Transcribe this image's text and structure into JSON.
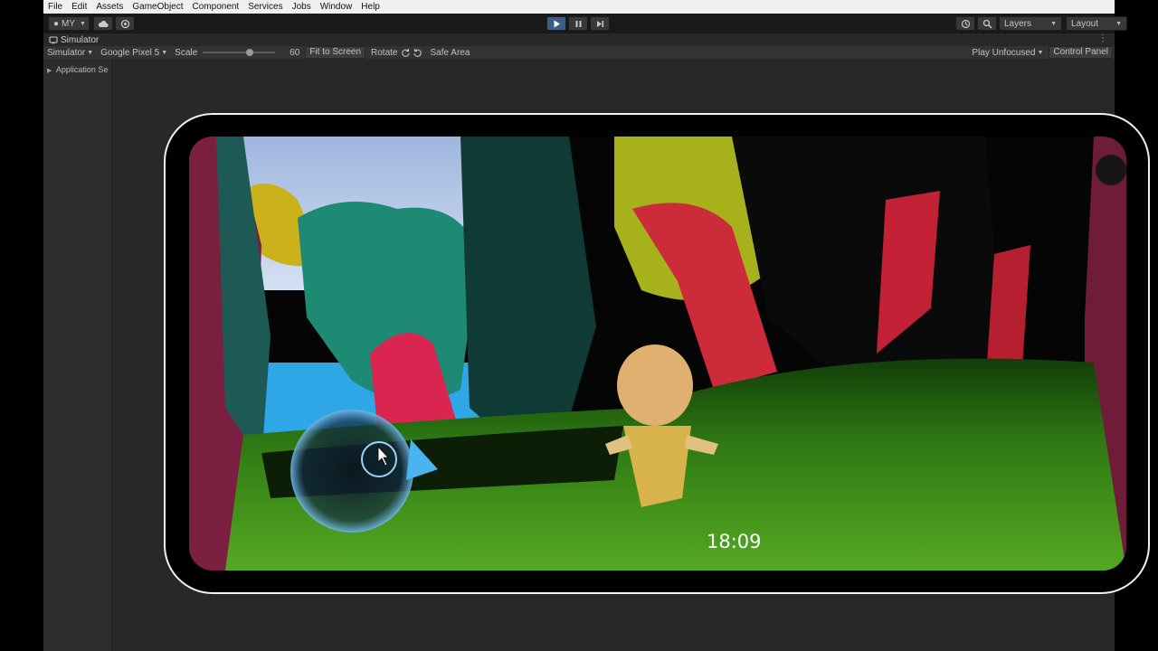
{
  "menubar": {
    "items": [
      "File",
      "Edit",
      "Assets",
      "GameObject",
      "Component",
      "Services",
      "Jobs",
      "Window",
      "Help"
    ]
  },
  "toolbar": {
    "account_label": "MY",
    "layers_label": "Layers",
    "layout_label": "Layout"
  },
  "window": {
    "tab_title": "Simulator"
  },
  "simbar": {
    "mode_label": "Simulator",
    "device_label": "Google Pixel 5",
    "scale_label": "Scale",
    "scale_value": "60",
    "fit_label": "Fit to Screen",
    "rotate_label": "Rotate",
    "safe_area_label": "Safe Area",
    "play_mode_label": "Play Unfocused",
    "control_panel_label": "Control Panel"
  },
  "sidebar": {
    "items": [
      {
        "label": "Application Se"
      }
    ]
  },
  "game": {
    "timer": "18:09"
  },
  "colors": {
    "menubar_bg": "#f0f0f0",
    "toolbar_bg": "#191919",
    "panel_bg": "#282828",
    "accent_play": "#3b5e89",
    "phone_frame": "#f2f2f2"
  }
}
